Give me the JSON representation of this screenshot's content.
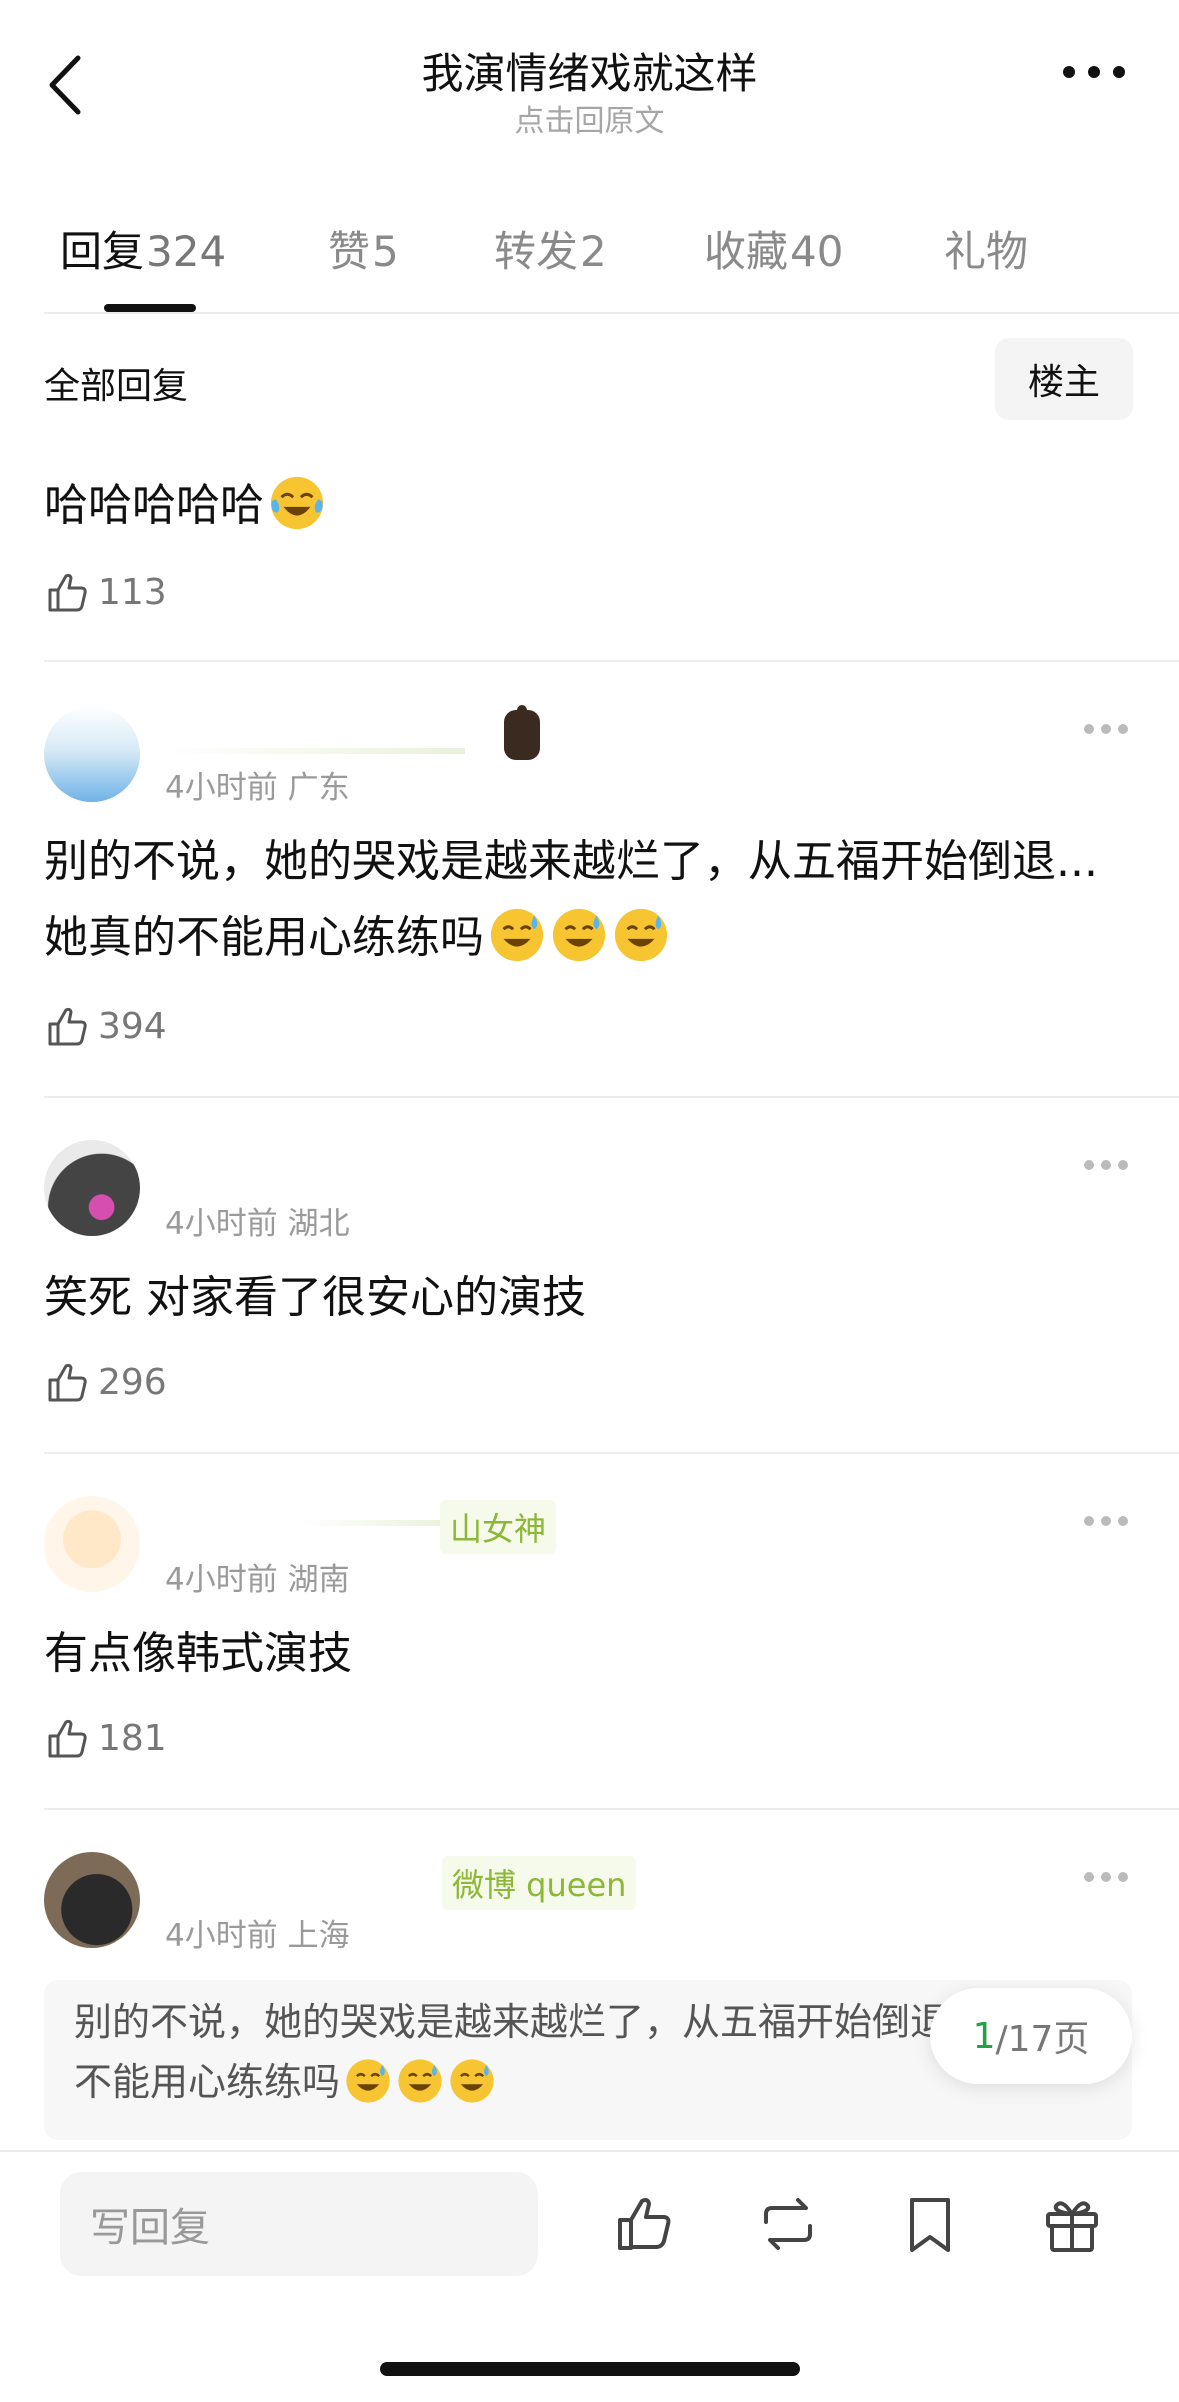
{
  "header": {
    "title": "我演情绪戏就这样",
    "subtitle": "点击回原文"
  },
  "tabs": [
    {
      "label": "回复",
      "count": "324"
    },
    {
      "label": "赞",
      "count": "5"
    },
    {
      "label": "转发",
      "count": "2"
    },
    {
      "label": "收藏",
      "count": "40"
    },
    {
      "label": "礼物",
      "count": ""
    }
  ],
  "section": {
    "title": "全部回复",
    "filter_label": "楼主"
  },
  "comments": [
    {
      "text": "哈哈哈哈哈",
      "emoji": "laughing-tears-emoji",
      "likes": "113"
    },
    {
      "meta": "4小时前 广东",
      "text": "别的不说，她的哭戏是越来越烂了，从五福开始倒退...她真的不能用心练练吗",
      "emoji": "sweat-smile-emoji",
      "likes": "394"
    },
    {
      "meta": "4小时前 湖北",
      "text": "笑死 对家看了很安心的演技",
      "likes": "296"
    },
    {
      "meta": "4小时前 湖南",
      "badge": "山女神",
      "text": "有点像韩式演技",
      "likes": "181"
    },
    {
      "meta": "4小时前 上海",
      "badge": "微博 queen"
    }
  ],
  "quote": {
    "text": "别的不说，她的哭戏是越来越烂了，从五福开始倒退...她真的不能用心练练吗"
  },
  "pager": {
    "current": "1",
    "total": "/17页"
  },
  "bottom_bar": {
    "reply_placeholder": "写回复"
  },
  "colors": {
    "accent_green": "#21a343",
    "badge_green": "#8cb737",
    "muted": "#9a9a9a"
  }
}
